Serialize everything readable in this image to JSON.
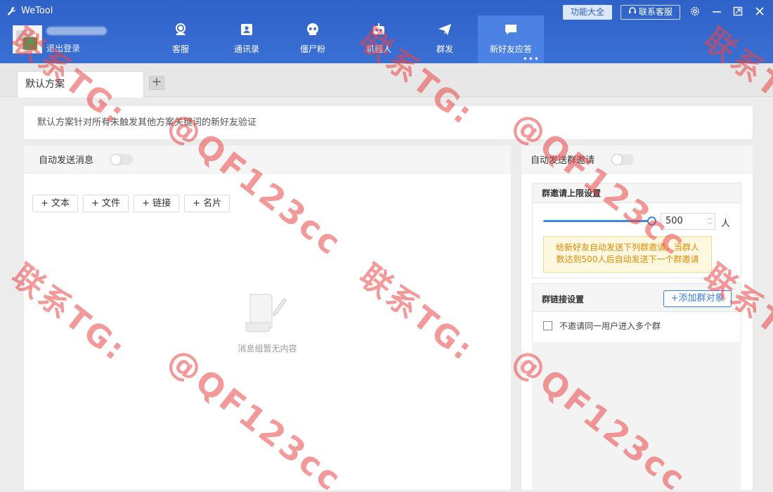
{
  "app": {
    "title": "WeTool"
  },
  "user": {
    "logout": "退出登录"
  },
  "nav": [
    {
      "label": "客服",
      "icon": "headset-icon"
    },
    {
      "label": "通讯录",
      "icon": "contacts-icon"
    },
    {
      "label": "僵尸粉",
      "icon": "skull-icon"
    },
    {
      "label": "机器人",
      "icon": "robot-icon"
    },
    {
      "label": "群发",
      "icon": "send-icon"
    },
    {
      "label": "新好友应答",
      "icon": "chat-icon",
      "active": true,
      "more": "•••"
    }
  ],
  "header_buttons": {
    "func": "功能大全",
    "contact": "联系客服"
  },
  "tabs": {
    "default_label": "默认方案",
    "add": "+"
  },
  "description": "默认方案针对所有未触发其他方案关键词的新好友验证",
  "left": {
    "title": "自动发送消息",
    "toggle_on": false,
    "buttons": [
      "+ 文本",
      "+ 文件",
      "+ 链接",
      "+ 名片"
    ],
    "empty_text": "消息组暂无内容"
  },
  "right": {
    "title": "自动发送群邀请",
    "toggle_on": false,
    "limit_section": "群邀请上限设置",
    "limit_value": "500",
    "limit_unit": "人",
    "slider_fraction": 1.0,
    "tip_line1": "给新好友自动发送下列群邀请，当群人",
    "tip_line2": "数达到500人后自动发送下一个群邀请",
    "link_section": "群链接设置",
    "add_group": "+添加群对象",
    "checkbox_label": "不邀请同一用户进入多个群",
    "checkbox_checked": false
  },
  "watermark": {
    "line1": "联系TG:",
    "line2": "@QF123cc"
  },
  "colors": {
    "header": "#2f62c9",
    "active_nav": "#4c82e3",
    "accent": "#3b7ddd",
    "watermark": "#eb4646"
  }
}
